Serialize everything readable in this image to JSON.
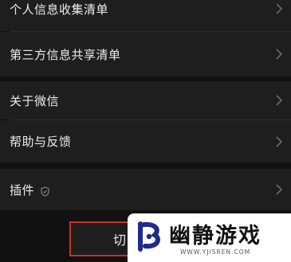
{
  "menu": {
    "items": [
      {
        "label": "个人信息收集清单"
      },
      {
        "label": "第三方信息共享清单"
      },
      {
        "label": "关于微信"
      },
      {
        "label": "帮助与反馈"
      },
      {
        "label": "插件"
      }
    ],
    "chevron_icon": "chevron-right-icon",
    "plugin_badge_icon": "shield-icon"
  },
  "bottom": {
    "switch_label": "切"
  },
  "watermark": {
    "title": "幽静游戏",
    "url": "WWW.YJISREN.COM"
  },
  "colors": {
    "background": "#111111",
    "row": "#1e1e1e",
    "text": "#ececec",
    "highlight": "#c8302c",
    "watermark_logo": "#1f2b8c"
  }
}
